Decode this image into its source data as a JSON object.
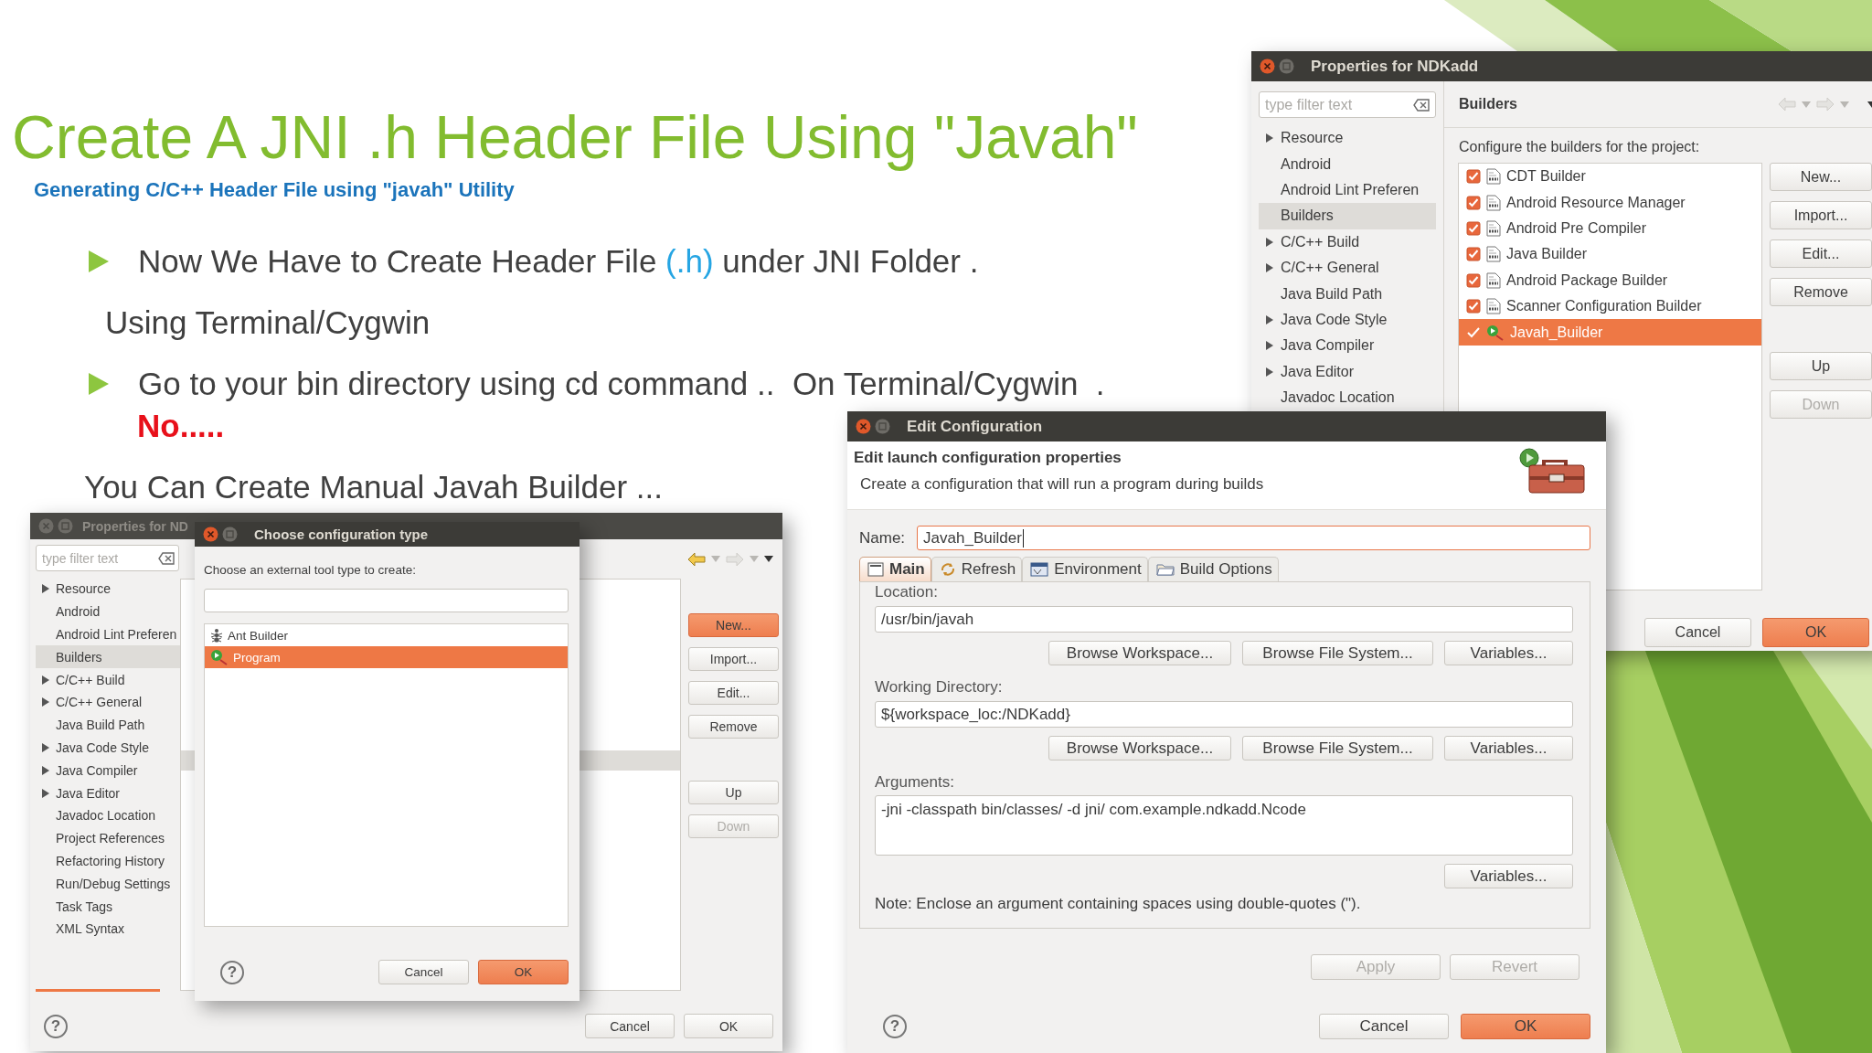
{
  "slide": {
    "title": "Create A JNI .h Header File Using \"Javah\"",
    "subtitle": "Generating C/C++ Header File using \"javah\" Utility",
    "lines": [
      {
        "kind": "bullet",
        "segments": [
          {
            "text": "Now We Have to Create Header File ",
            "highlight": false
          },
          {
            "text": "(.h)",
            "highlight": true
          },
          {
            "text": " under JNI Folder .",
            "highlight": false
          }
        ]
      },
      {
        "kind": "indent",
        "segments": [
          {
            "text": "Using Terminal/Cygwin",
            "highlight": false
          }
        ]
      },
      {
        "kind": "bullet",
        "segments": [
          {
            "text": "Go to your bin directory using cd command ..  On Terminal/Cygwin  .",
            "highlight": false
          }
        ]
      },
      {
        "kind": "alert",
        "segments": [
          {
            "text": "No.....",
            "highlight": false
          }
        ]
      },
      {
        "kind": "plain",
        "segments": [
          {
            "text": "You Can Create Manual Javah Builder ...",
            "highlight": false
          }
        ]
      }
    ]
  },
  "properties": {
    "title": "Properties for NDKadd",
    "filter_placeholder": "type filter text",
    "tree": [
      {
        "label": "Resource",
        "expandable": true,
        "selected": false
      },
      {
        "label": "Android",
        "expandable": false,
        "selected": false
      },
      {
        "label": "Android Lint Preferen",
        "expandable": false,
        "selected": false
      },
      {
        "label": "Builders",
        "expandable": false,
        "selected": true
      },
      {
        "label": "C/C++ Build",
        "expandable": true,
        "selected": false
      },
      {
        "label": "C/C++ General",
        "expandable": true,
        "selected": false
      },
      {
        "label": "Java Build Path",
        "expandable": false,
        "selected": false
      },
      {
        "label": "Java Code Style",
        "expandable": true,
        "selected": false
      },
      {
        "label": "Java Compiler",
        "expandable": true,
        "selected": false
      },
      {
        "label": "Java Editor",
        "expandable": true,
        "selected": false
      },
      {
        "label": "Javadoc Location",
        "expandable": false,
        "selected": false
      }
    ],
    "page_title": "Builders",
    "description": "Configure the builders for the project:",
    "builders": [
      {
        "label": "CDT Builder",
        "kind": "file",
        "checked": true,
        "selected": false
      },
      {
        "label": "Android Resource Manager",
        "kind": "file",
        "checked": true,
        "selected": false
      },
      {
        "label": "Android Pre Compiler",
        "kind": "file",
        "checked": true,
        "selected": false
      },
      {
        "label": "Java Builder",
        "kind": "file",
        "checked": true,
        "selected": false
      },
      {
        "label": "Android Package Builder",
        "kind": "file",
        "checked": true,
        "selected": false
      },
      {
        "label": "Scanner Configuration Builder",
        "kind": "file",
        "checked": true,
        "selected": false
      },
      {
        "label": "Javah_Builder",
        "kind": "program",
        "checked": true,
        "selected": true
      }
    ],
    "buttons": [
      {
        "label": "New...",
        "disabled": false
      },
      {
        "label": "Import...",
        "disabled": false
      },
      {
        "label": "Edit...",
        "disabled": false
      },
      {
        "label": "Remove",
        "disabled": false
      }
    ],
    "move_buttons": [
      {
        "label": "Up",
        "disabled": false
      },
      {
        "label": "Down",
        "disabled": true
      }
    ],
    "footer_buttons": [
      {
        "label": "Cancel",
        "default": false
      },
      {
        "label": "OK",
        "default": true
      }
    ]
  },
  "back_properties": {
    "title": "Properties for ND",
    "filter_placeholder": "type filter text",
    "tree": [
      {
        "label": "Resource",
        "expandable": true,
        "selected": false
      },
      {
        "label": "Android",
        "expandable": false,
        "selected": false
      },
      {
        "label": "Android Lint Preferen",
        "expandable": false,
        "selected": false
      },
      {
        "label": "Builders",
        "expandable": false,
        "selected": true
      },
      {
        "label": "C/C++ Build",
        "expandable": true,
        "selected": false
      },
      {
        "label": "C/C++ General",
        "expandable": true,
        "selected": false
      },
      {
        "label": "Java Build Path",
        "expandable": false,
        "selected": false
      },
      {
        "label": "Java Code Style",
        "expandable": true,
        "selected": false
      },
      {
        "label": "Java Compiler",
        "expandable": true,
        "selected": false
      },
      {
        "label": "Java Editor",
        "expandable": true,
        "selected": false
      },
      {
        "label": "Javadoc Location",
        "expandable": false,
        "selected": false
      },
      {
        "label": "Project References",
        "expandable": false,
        "selected": false
      },
      {
        "label": "Refactoring History",
        "expandable": false,
        "selected": false
      },
      {
        "label": "Run/Debug Settings",
        "expandable": false,
        "selected": false
      },
      {
        "label": "Task Tags",
        "expandable": false,
        "selected": false
      },
      {
        "label": "XML Syntax",
        "expandable": false,
        "selected": false
      }
    ],
    "buttons": [
      {
        "label": "New...",
        "default": true
      },
      {
        "label": "Import...",
        "default": false
      },
      {
        "label": "Edit...",
        "default": false
      },
      {
        "label": "Remove",
        "default": false
      }
    ],
    "move_buttons": [
      {
        "label": "Up",
        "disabled": false
      },
      {
        "label": "Down",
        "disabled": true
      }
    ],
    "help": "?",
    "footer_buttons": [
      {
        "label": "Cancel",
        "default": false
      },
      {
        "label": "OK",
        "default": false
      }
    ]
  },
  "choose_dialog": {
    "title": "Choose configuration type",
    "prompt": "Choose an external tool type to create:",
    "types": [
      {
        "label": "Ant Builder",
        "kind": "ant",
        "selected": false
      },
      {
        "label": "Program",
        "kind": "program",
        "selected": true
      }
    ],
    "help": "?",
    "buttons": [
      {
        "label": "Cancel",
        "default": false
      },
      {
        "label": "OK",
        "default": true
      }
    ]
  },
  "edit_dialog": {
    "title": "Edit Configuration",
    "heading": "Edit launch configuration properties",
    "description": "Create a configuration that will run a program during builds",
    "name_label": "Name:",
    "name_value": "Javah_Builder",
    "tabs": [
      {
        "label": "Main",
        "kind": "main",
        "selected": true
      },
      {
        "label": "Refresh",
        "kind": "refresh",
        "selected": false
      },
      {
        "label": "Environment",
        "kind": "environment",
        "selected": false
      },
      {
        "label": "Build Options",
        "kind": "build",
        "selected": false
      }
    ],
    "location": {
      "label": "Location:",
      "value": "/usr/bin/javah",
      "buttons": [
        "Browse Workspace...",
        "Browse File System...",
        "Variables..."
      ]
    },
    "working_directory": {
      "label": "Working Directory:",
      "value": "${workspace_loc:/NDKadd}",
      "buttons": [
        "Browse Workspace...",
        "Browse File System...",
        "Variables..."
      ]
    },
    "arguments": {
      "label": "Arguments:",
      "value": "-jni -classpath bin/classes/ -d jni/ com.example.ndkadd.Ncode",
      "buttons": [
        "Variables..."
      ],
      "note": "Note: Enclose an argument containing spaces using double-quotes (\")."
    },
    "actions": [
      {
        "label": "Apply",
        "disabled": true
      },
      {
        "label": "Revert",
        "disabled": true
      }
    ],
    "help": "?",
    "footer_buttons": [
      {
        "label": "Cancel",
        "default": false
      },
      {
        "label": "OK",
        "default": true
      }
    ]
  }
}
